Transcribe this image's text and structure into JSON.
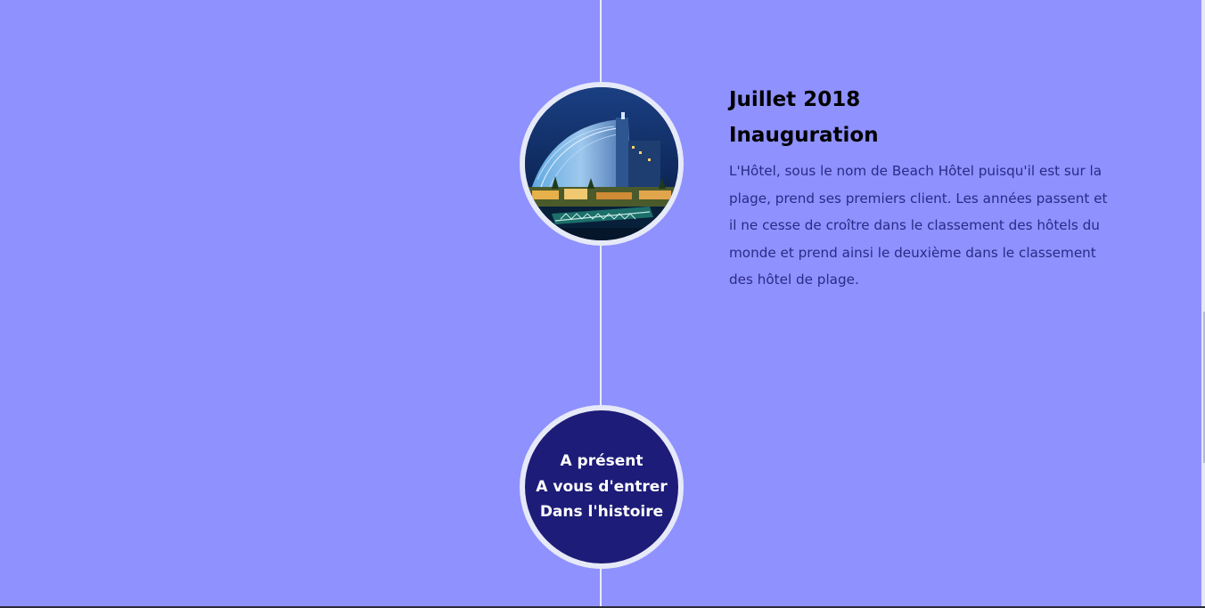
{
  "timeline": {
    "event": {
      "date": "Juillet 2018",
      "title": "Inauguration",
      "description": "L'Hôtel, sous le nom de Beach Hôtel puisqu'il est sur la plage, prend ses premiers client. Les années passent et il ne cesse de croître dans le classement des hôtels du monde et prend ainsi le deuxième dans le classement des hôtel de plage.",
      "image": "hotel-photo-icon"
    },
    "final": {
      "line1": "A présent",
      "line2": "A vous d'entrer",
      "line3": "Dans l'histoire"
    }
  },
  "colors": {
    "background": "#8f91ff",
    "line": "#e9ecf8",
    "final_circle": "#1d1c78",
    "description_text": "#2a2a86"
  }
}
